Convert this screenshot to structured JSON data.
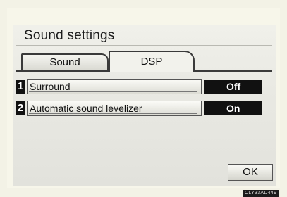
{
  "window": {
    "title": "Sound settings"
  },
  "tabs": [
    {
      "label": "Sound",
      "active": false
    },
    {
      "label": "DSP",
      "active": true
    }
  ],
  "rows": [
    {
      "number": "1",
      "label": "Surround",
      "value": "Off"
    },
    {
      "number": "2",
      "label": "Automatic sound levelizer",
      "value": "On"
    }
  ],
  "buttons": {
    "ok_label": "OK"
  },
  "figure_code": "CLY33AD449"
}
